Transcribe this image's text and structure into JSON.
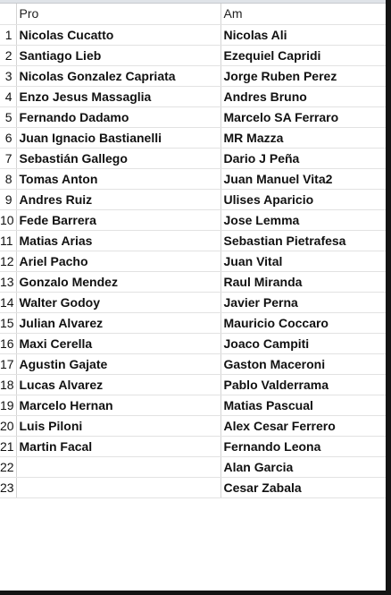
{
  "sheet": {
    "headers": {
      "num": "",
      "pro": "Pro",
      "am": "Am"
    },
    "rows": [
      {
        "num": "1",
        "pro": "Nicolas Cucatto",
        "am": "Nicolas Ali"
      },
      {
        "num": "2",
        "pro": "Santiago Lieb",
        "am": "Ezequiel Capridi"
      },
      {
        "num": "3",
        "pro": "Nicolas Gonzalez Capriata",
        "am": "Jorge Ruben Perez"
      },
      {
        "num": "4",
        "pro": "Enzo Jesus Massaglia",
        "am": "Andres Bruno"
      },
      {
        "num": "5",
        "pro": "Fernando Dadamo",
        "am": "Marcelo SA Ferraro"
      },
      {
        "num": "6",
        "pro": "Juan Ignacio Bastianelli",
        "am": "MR Mazza"
      },
      {
        "num": "7",
        "pro": "Sebastián Gallego",
        "am": "Dario J Peña"
      },
      {
        "num": "8",
        "pro": "Tomas Anton",
        "am": "Juan Manuel Vita2"
      },
      {
        "num": "9",
        "pro": "Andres Ruiz",
        "am": "Ulises Aparicio"
      },
      {
        "num": "10",
        "pro": "Fede Barrera",
        "am": "Jose Lemma"
      },
      {
        "num": "11",
        "pro": "Matias Arias",
        "am": "Sebastian Pietrafesa"
      },
      {
        "num": "12",
        "pro": "Ariel Pacho",
        "am": "Juan Vital"
      },
      {
        "num": "13",
        "pro": "Gonzalo Mendez",
        "am": "Raul Miranda"
      },
      {
        "num": "14",
        "pro": "Walter Godoy",
        "am": "Javier Perna"
      },
      {
        "num": "15",
        "pro": "Julian Alvarez",
        "am": "Mauricio Coccaro"
      },
      {
        "num": "16",
        "pro": "Maxi Cerella",
        "am": "Joaco Campiti"
      },
      {
        "num": "17",
        "pro": "Agustin Gajate",
        "am": "Gaston Maceroni"
      },
      {
        "num": "18",
        "pro": "Lucas Alvarez",
        "am": "Pablo Valderrama"
      },
      {
        "num": "19",
        "pro": "Marcelo Hernan",
        "am": "Matias Pascual"
      },
      {
        "num": "20",
        "pro": "Luis Piloni",
        "am": "Alex Cesar Ferrero"
      },
      {
        "num": "21",
        "pro": "Martin Facal",
        "am": "Fernando Leona"
      },
      {
        "num": "22",
        "pro": "",
        "am": "Alan Garcia"
      },
      {
        "num": "23",
        "pro": "",
        "am": "Cesar Zabala"
      }
    ]
  }
}
